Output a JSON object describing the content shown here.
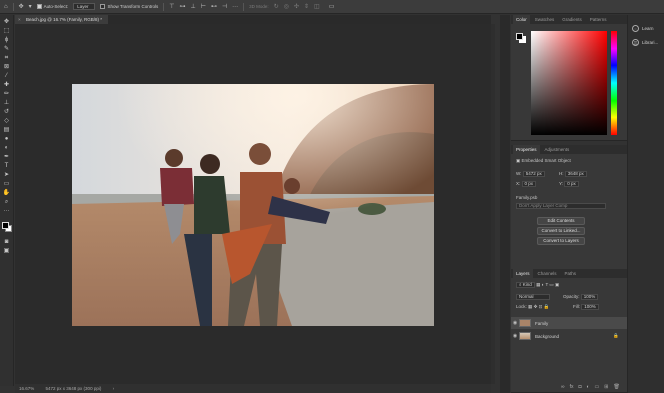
{
  "options_bar": {
    "auto_select_label": "Auto-Select:",
    "auto_select_target": "Layer",
    "show_transform_label": "Show Transform Controls",
    "mode_3d_label": "3D Mode:"
  },
  "document": {
    "tab_title": "Beach.jpg @ 16.7% (Family, RGB/8) *",
    "zoom": "16.67%",
    "doc_info": "5472 px x 3648 px (300 ppi)"
  },
  "color_panel": {
    "tabs": [
      "Color",
      "Swatches",
      "Gradients",
      "Patterns"
    ]
  },
  "properties_panel": {
    "tabs": [
      "Properties",
      "Adjustments"
    ],
    "object_type": "Embedded Smart Object",
    "w_label": "W:",
    "w_value": "5472 px",
    "h_label": "H:",
    "h_value": "3648 px",
    "x_label": "X:",
    "x_value": "0 px",
    "y_label": "Y:",
    "y_value": "0 px",
    "file_name": "Family.psb",
    "layer_comp_placeholder": "Don't Apply Layer Comp",
    "edit_contents": "Edit Contents",
    "convert_linked": "Convert to Linked...",
    "convert_layers": "Convert to Layers"
  },
  "layers_panel": {
    "tabs": [
      "Layers",
      "Channels",
      "Paths"
    ],
    "kind_label": "Kind",
    "blend_mode": "Normal",
    "opacity_label": "Opacity:",
    "opacity_value": "100%",
    "lock_label": "Lock:",
    "fill_label": "Fill:",
    "fill_value": "100%",
    "layers": [
      {
        "name": "Family",
        "selected": true
      },
      {
        "name": "Background",
        "selected": false
      }
    ]
  },
  "mini_dock": {
    "items": [
      "Learn",
      "Librari..."
    ]
  }
}
